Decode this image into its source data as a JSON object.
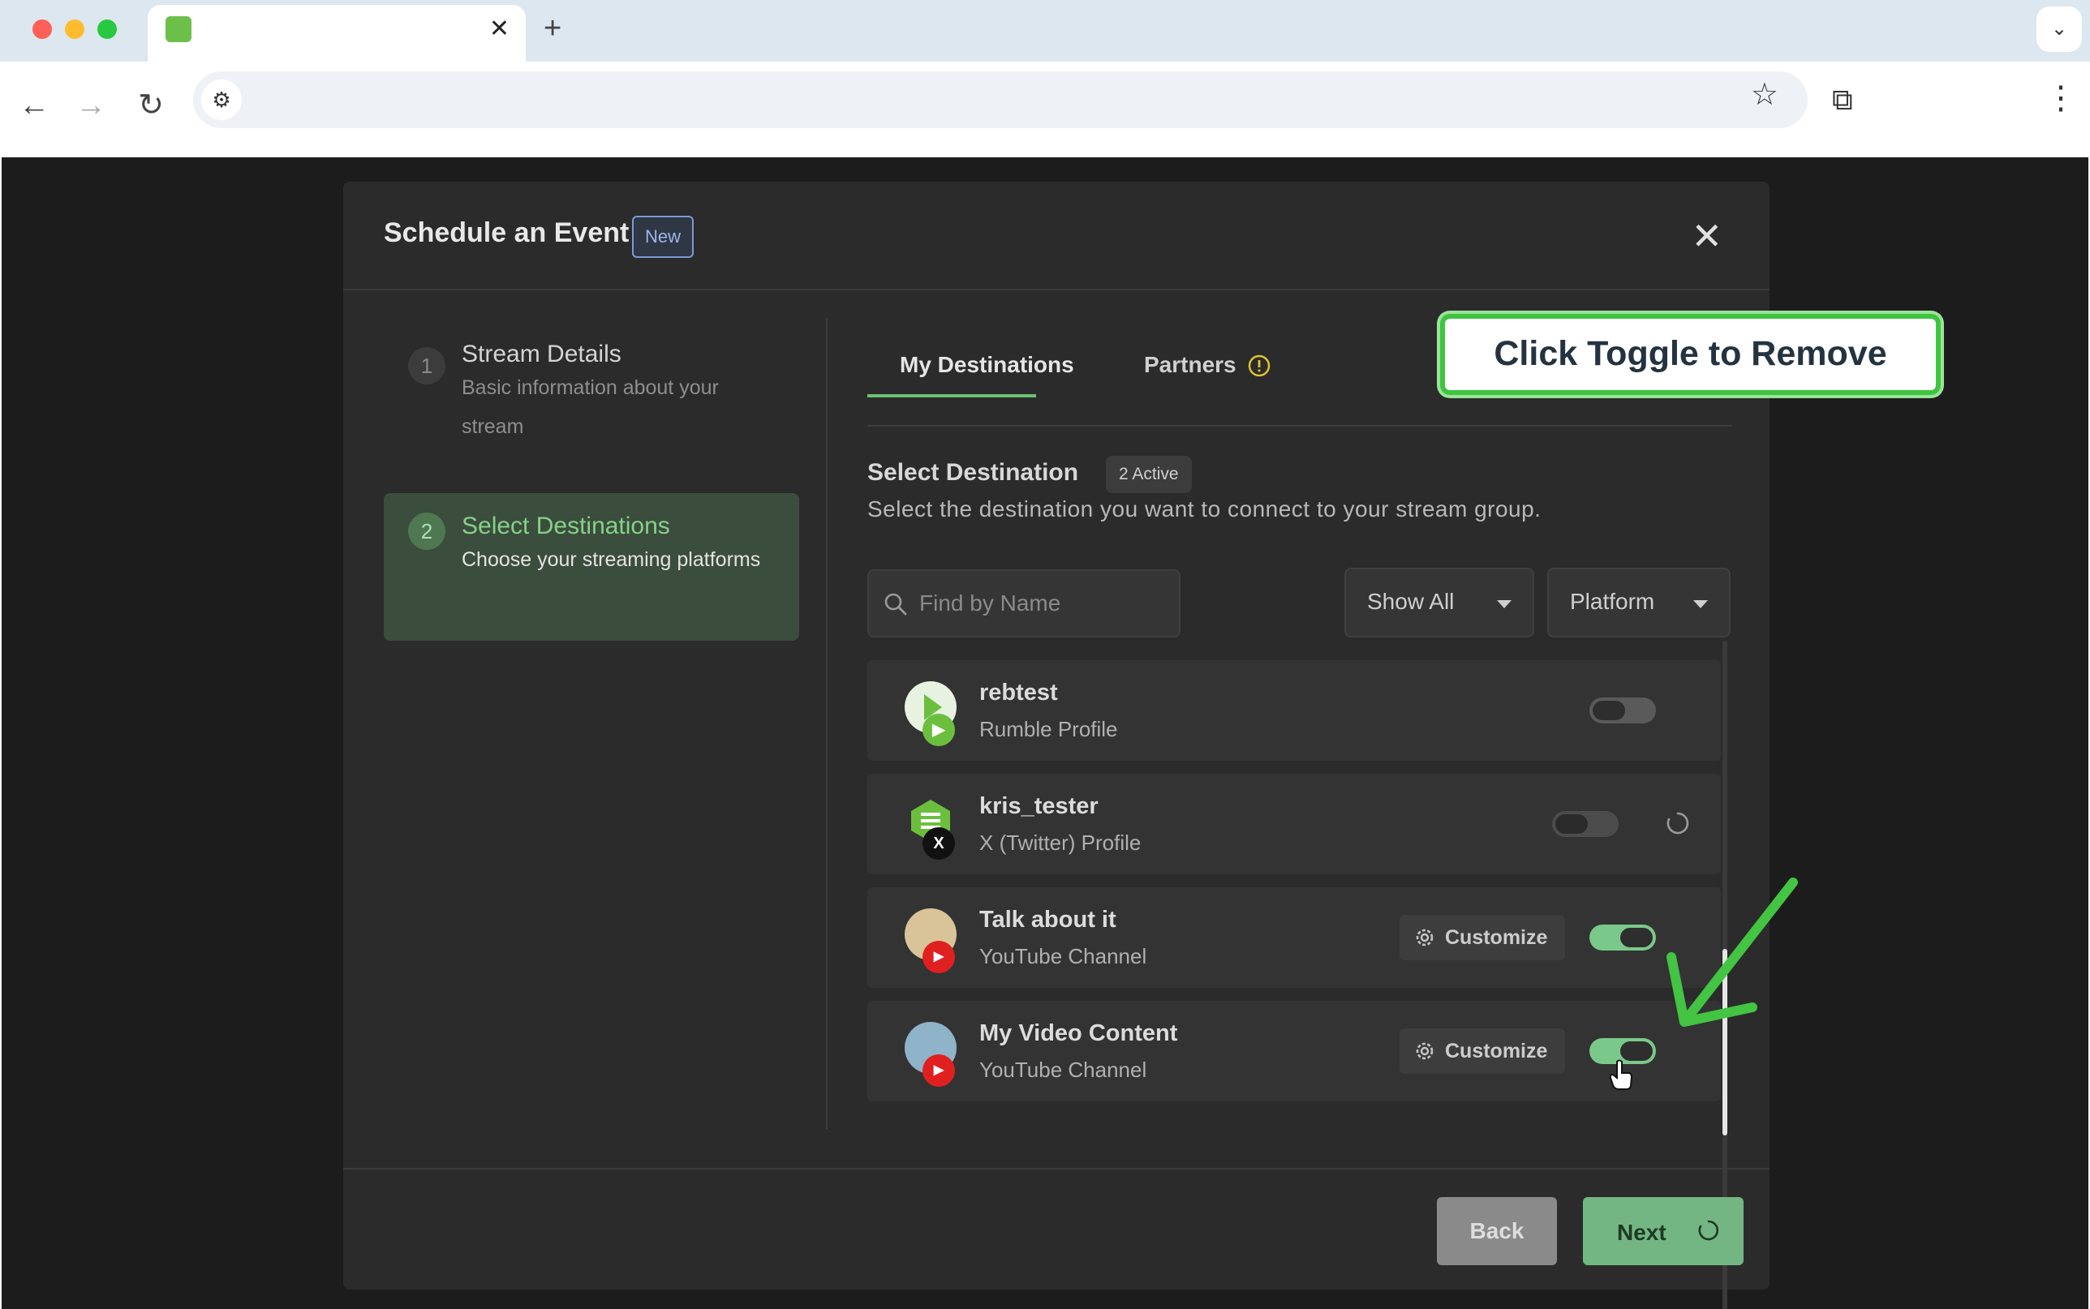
{
  "browser": {
    "tab_close": "✕",
    "new_tab": "+",
    "menu": "⌄"
  },
  "modal": {
    "title": "Schedule an Event",
    "badge": "New",
    "close": "✕"
  },
  "steps": [
    {
      "number": "1",
      "title": "Stream Details",
      "desc": "Basic information about your stream",
      "active": false
    },
    {
      "number": "2",
      "title": "Select Destinations",
      "desc": "Choose your streaming platforms",
      "active": true
    }
  ],
  "tabs": {
    "my_destinations": "My Destinations",
    "partners": "Partners"
  },
  "select": {
    "title": "Select Destination",
    "active_badge": "2 Active",
    "description": "Select the destination you want to connect to your stream group."
  },
  "search": {
    "placeholder": "Find by Name"
  },
  "filters": {
    "show": "Show All",
    "platform": "Platform"
  },
  "destinations": [
    {
      "name": "rebtest",
      "type": "Rumble Profile",
      "enabled": false,
      "platform": "rumble",
      "customize": false
    },
    {
      "name": "kris_tester",
      "type": "X (Twitter) Profile",
      "enabled": false,
      "platform": "x",
      "customize": false,
      "loading": true
    },
    {
      "name": "Talk about it",
      "type": "YouTube Channel",
      "enabled": true,
      "platform": "youtube",
      "customize": true,
      "customize_label": "Customize"
    },
    {
      "name": "My Video Content",
      "type": "YouTube Channel",
      "enabled": true,
      "platform": "youtube",
      "customize": true,
      "customize_label": "Customize"
    }
  ],
  "footer": {
    "back": "Back",
    "next": "Next"
  },
  "annotation": {
    "callout": "Click Toggle to Remove"
  },
  "colors": {
    "accent_green": "#6cc070",
    "toggle_on": "#7ac98a",
    "callout_border": "#3fc43f"
  }
}
